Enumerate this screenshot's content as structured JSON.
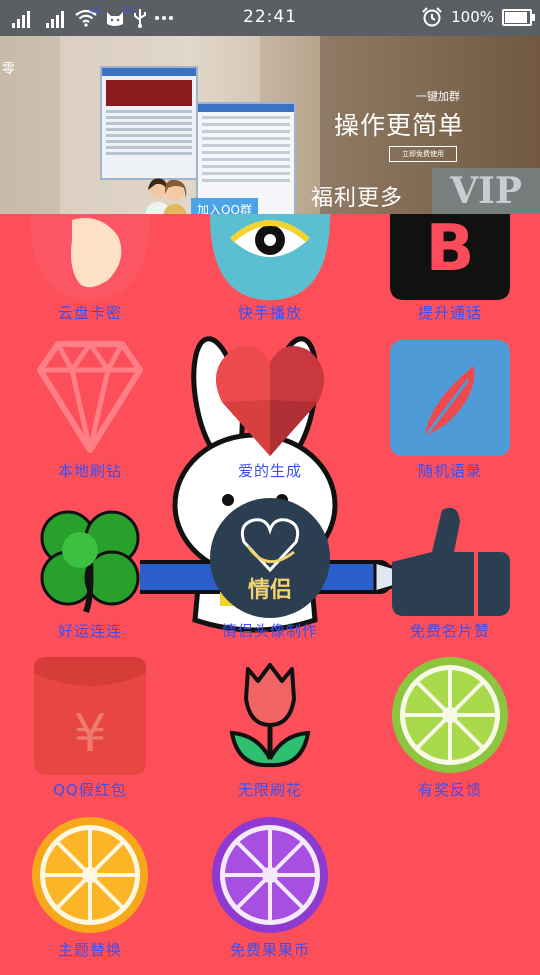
{
  "status_bar": {
    "sim1": "4G",
    "sim2": "2G",
    "time": "22:41",
    "battery_text": "100%",
    "battery_level": 1.0,
    "icons": [
      "signal-4g-icon",
      "signal-2g-icon",
      "wifi-icon",
      "cat-notification-icon",
      "usb-icon",
      "more-dots-icon",
      "alarm-icon",
      "battery-icon"
    ]
  },
  "banner": {
    "left_char": "零",
    "join_button": "加入QQ群",
    "one_key": "一键加群",
    "headline": "操作更简单",
    "free_use": "立即免费使用",
    "welfare": "福利更多",
    "vip": "VIP"
  },
  "grid": [
    {
      "label": "云盘卡密",
      "icon": "card-icon"
    },
    {
      "label": "快手播放",
      "icon": "eye-icon"
    },
    {
      "label": "提升通话",
      "icon": "letter-b-icon"
    },
    {
      "label": "本地刷钻",
      "icon": "diamond-icon"
    },
    {
      "label": "爱的生成",
      "icon": "heart-icon"
    },
    {
      "label": "随机语录",
      "icon": "feather-icon"
    },
    {
      "label": "好运连连",
      "icon": "clover-icon"
    },
    {
      "label": "情侣头像制作",
      "icon": "couple-heart-icon",
      "badge": "情侣"
    },
    {
      "label": "免费名片赞",
      "icon": "thumbs-up-icon"
    },
    {
      "label": "QQ假红包",
      "icon": "red-envelope-icon"
    },
    {
      "label": "无限刷花",
      "icon": "tulip-icon"
    },
    {
      "label": "有奖反馈",
      "icon": "lime-icon"
    },
    {
      "label": "主题替换",
      "icon": "orange-icon"
    },
    {
      "label": "免费果果币",
      "icon": "grape-fruit-icon"
    }
  ],
  "colors": {
    "background": "#fd4f59",
    "label": "#3c4ff0",
    "status_bar": "#5b5f63"
  }
}
